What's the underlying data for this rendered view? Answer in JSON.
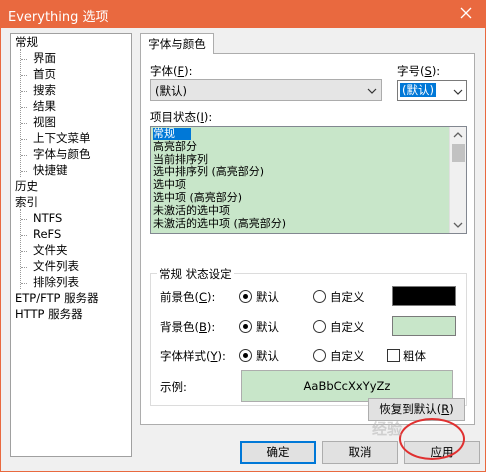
{
  "window": {
    "title": "Everything 选项",
    "accent": "#e9693f"
  },
  "tree": [
    {
      "label": "常规",
      "level": 0
    },
    {
      "label": "界面",
      "level": 1
    },
    {
      "label": "首页",
      "level": 1
    },
    {
      "label": "搜索",
      "level": 1
    },
    {
      "label": "结果",
      "level": 1
    },
    {
      "label": "视图",
      "level": 1
    },
    {
      "label": "上下文菜单",
      "level": 1
    },
    {
      "label": "字体与颜色",
      "level": 1
    },
    {
      "label": "快捷键",
      "level": 1
    },
    {
      "label": "历史",
      "level": 0
    },
    {
      "label": "索引",
      "level": 0
    },
    {
      "label": "NTFS",
      "level": 1
    },
    {
      "label": "ReFS",
      "level": 1
    },
    {
      "label": "文件夹",
      "level": 1
    },
    {
      "label": "文件列表",
      "level": 1
    },
    {
      "label": "排除列表",
      "level": 1
    },
    {
      "label": "ETP/FTP 服务器",
      "level": 0
    },
    {
      "label": "HTTP 服务器",
      "level": 0
    }
  ],
  "tab": {
    "label": "字体与颜色"
  },
  "font": {
    "label_pre": "字体(",
    "label_key": "F",
    "label_post": "):",
    "value": "(默认)",
    "size_label_pre": "字号(",
    "size_label_key": "S",
    "size_label_post": "):",
    "size_value": "(默认)"
  },
  "item_state": {
    "label_pre": "项目状态(",
    "label_key": "I",
    "label_post": "):",
    "items": [
      "常规",
      "高亮部分",
      "当前排序列",
      "选中排序列 (高亮部分)",
      "选中项",
      "选中项 (高亮部分)",
      "未激活的选中项",
      "未激活的选中项 (高亮部分)"
    ],
    "selected": "常规"
  },
  "group": {
    "title": "常规 状态设定",
    "fg_label_pre": "前景色(",
    "fg_label_key": "C",
    "fg_label_post": "):",
    "bg_label_pre": "背景色(",
    "bg_label_key": "B",
    "bg_label_post": "):",
    "style_label_pre": "字体样式(",
    "style_label_key": "Y",
    "style_label_post": "):",
    "default_label": "默认",
    "custom_label": "自定义",
    "bold_label": "粗体",
    "sample_label": "示例:",
    "sample_text": "AaBbCcXxYyZz",
    "fg_color": "#000000",
    "bg_color": "#c8e6c9"
  },
  "buttons": {
    "restore_pre": "恢复到默认(",
    "restore_key": "R",
    "restore_post": ")",
    "ok": "确定",
    "cancel": "取消",
    "apply": "应用"
  },
  "watermark": "经验"
}
